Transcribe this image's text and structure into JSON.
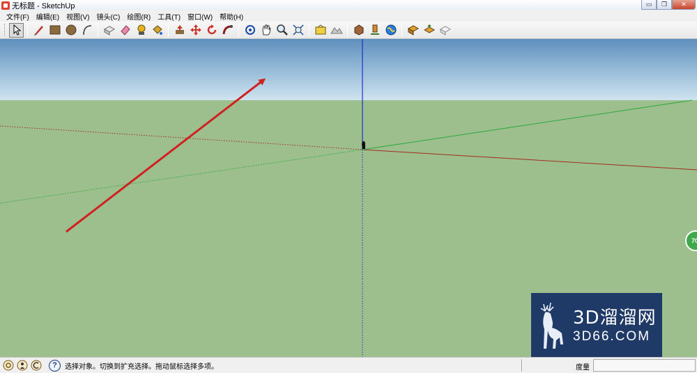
{
  "window": {
    "title": "无标题 - SketchUp",
    "minimize_glyph": "▭",
    "restore_glyph": "❐",
    "close_glyph": "✕"
  },
  "menu": {
    "items": [
      "文件(F)",
      "编辑(E)",
      "视图(V)",
      "镜头(C)",
      "绘图(R)",
      "工具(T)",
      "窗口(W)",
      "帮助(H)"
    ]
  },
  "toolbar": {
    "groups": [
      [
        "select-arrow-icon"
      ],
      [
        "pencil-line-icon",
        "rectangle-icon",
        "circle-icon",
        "arc-icon"
      ],
      [
        "make-component-icon",
        "eraser-icon",
        "tape-measure-icon",
        "paint-bucket-icon"
      ],
      [
        "push-pull-icon",
        "move-icon",
        "rotate-icon",
        "follow-me-icon"
      ],
      [
        "orbit-icon",
        "pan-hand-icon",
        "zoom-icon",
        "zoom-extents-icon"
      ],
      [
        "add-location-icon",
        "toggle-terrain-icon"
      ],
      [
        "get-models-icon",
        "share-model-icon",
        "google-earth-icon"
      ],
      [
        "get-components-icon",
        "share-component-icon",
        "sketchup-3d-warehouse-icon"
      ]
    ]
  },
  "viewport": {
    "badge_text": "70",
    "colors": {
      "sky_top": "#5e8fbd",
      "ground": "#9cbf8d",
      "red_axis": "#a32b1e",
      "green_axis": "#2aa83a",
      "blue_axis": "#1d2fd0",
      "annotation_arrow": "#d12020"
    }
  },
  "watermark": {
    "brand_cn": "3D溜溜网",
    "brand_url": "3D66.COM",
    "background": "#1f3a66"
  },
  "statusbar": {
    "help_glyph": "?",
    "status_text": "选择对象。切换到扩充选择。拖动鼠标选择多项。",
    "measure_label": "度量",
    "measure_value": ""
  }
}
